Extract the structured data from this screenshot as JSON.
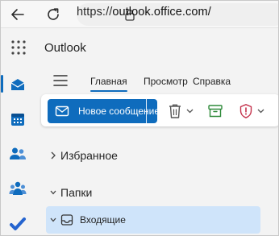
{
  "browser": {
    "url_prefix": "https://",
    "url_host": "outlook.office.com/"
  },
  "app": {
    "title": "Outlook"
  },
  "rail": {
    "items": [
      {
        "icon": "mail-icon",
        "active": true
      },
      {
        "icon": "calendar-icon"
      },
      {
        "icon": "people-icon"
      },
      {
        "icon": "groups-icon"
      },
      {
        "icon": "todo-icon"
      }
    ]
  },
  "ribbon": {
    "tabs": [
      {
        "label": "Главная",
        "active": true
      },
      {
        "label": "Просмотр"
      },
      {
        "label": "Справка"
      }
    ],
    "new_mail_label": "Новое сообщение"
  },
  "folders": {
    "favorites_label": "Избранное",
    "folders_label": "Папки",
    "inbox_label": "Входящие"
  },
  "colors": {
    "accent": "#0f6cbd",
    "selected_row": "#cfe4fa",
    "report_red": "#c4314b",
    "archive_green": "#2f8a3a"
  }
}
